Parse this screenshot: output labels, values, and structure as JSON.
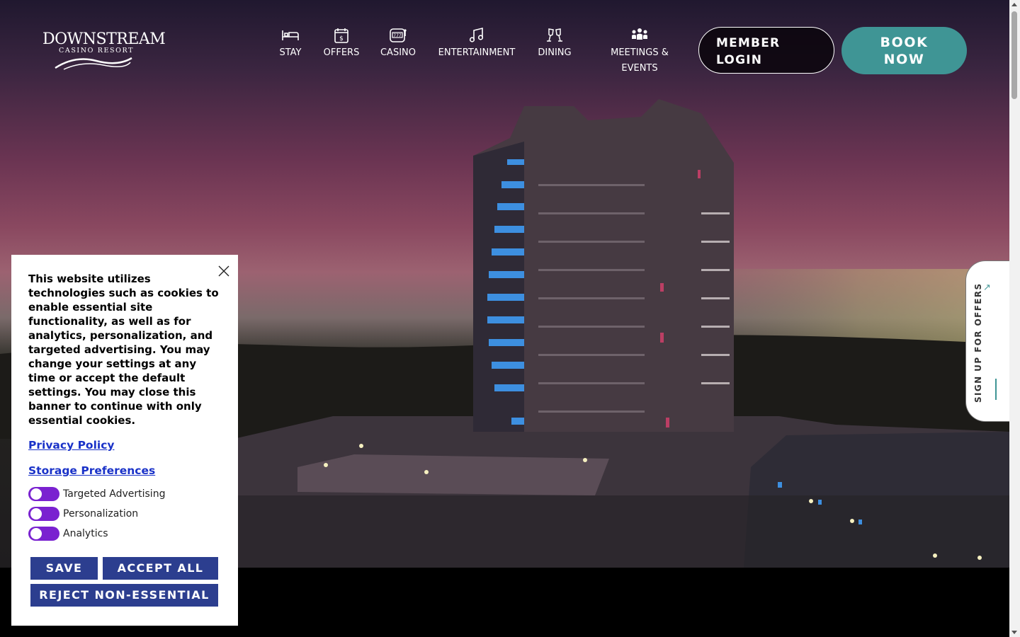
{
  "logo": {
    "line1": "DOWNSTREAM",
    "line2": "CASINO RESORT"
  },
  "nav": [
    {
      "label": "STAY",
      "icon": "bed-icon"
    },
    {
      "label": "OFFERS",
      "icon": "calendar-dollar-icon"
    },
    {
      "label": "CASINO",
      "icon": "slot-machine-icon"
    },
    {
      "label": "ENTERTAINMENT",
      "icon": "music-note-icon"
    },
    {
      "label": "DINING",
      "icon": "cheers-glasses-icon"
    },
    {
      "label": "MEETINGS & EVENTS",
      "icon": "people-group-icon"
    }
  ],
  "header": {
    "member_login": "MEMBER\nLOGIN",
    "book_now": "BOOK\nNOW"
  },
  "signup_tab": {
    "label": "SIGN UP FOR OFFERS"
  },
  "cookie": {
    "message": "This website utilizes technologies such as cookies to enable essential site functionality, as well as for analytics, personalization, and targeted advertising. You may change your settings at any time or accept the default settings. You may close this banner to continue with only essential cookies.",
    "privacy_link": "Privacy Policy",
    "storage_link": "Storage Preferences",
    "toggles": [
      "Targeted Advertising",
      "Personalization",
      "Analytics"
    ],
    "save": "SAVE",
    "accept_all": "ACCEPT ALL",
    "reject": "REJECT NON-ESSENTIAL"
  },
  "colors": {
    "accent_teal": "#3f9595",
    "cookie_button": "#2c3e8f",
    "toggle": "#7a22d0",
    "link": "#1a32c8"
  }
}
